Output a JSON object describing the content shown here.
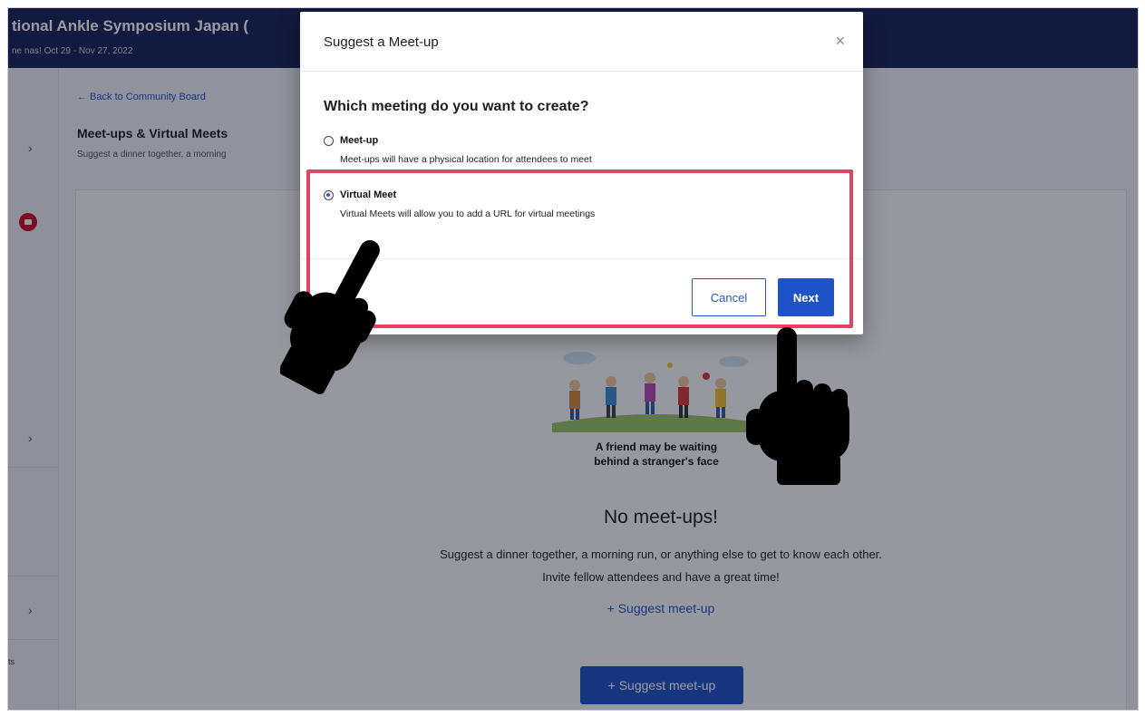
{
  "event": {
    "title": "tional Ankle Symposium Japan (",
    "dates": "ne nas!  Oct 29 - Nov 27, 2022"
  },
  "sidebar": {
    "chevron": "›",
    "footer_text": "ts"
  },
  "page": {
    "back_link": "← Back to Community Board",
    "title": "Meet-ups & Virtual Meets",
    "subtitle": "Suggest a dinner together, a morning"
  },
  "empty_state": {
    "caption_line1": "A friend may be waiting",
    "caption_line2": "behind a stranger's face",
    "title": "No meet-ups!",
    "body_line1": "Suggest a dinner together, a morning run, or anything else to get to know each other.",
    "body_line2": "Invite fellow attendees and have a great time!",
    "suggest_link": "+ Suggest meet-up",
    "suggest_button": "+ Suggest meet-up"
  },
  "modal": {
    "title": "Suggest a Meet-up",
    "close": "×",
    "question": "Which meeting do you want to create?",
    "options": [
      {
        "label": "Meet-up",
        "description": "Meet-ups will have a physical location for attendees to meet",
        "selected": false
      },
      {
        "label": "Virtual Meet",
        "description": "Virtual Meets will allow you to add a URL for virtual meetings",
        "selected": true
      }
    ],
    "cancel": "Cancel",
    "next": "Next"
  },
  "colors": {
    "header_bg": "#1b2356",
    "accent": "#1f53c7",
    "highlight": "#e0445f",
    "badge": "#c8102e"
  },
  "icons": {
    "close": "close-icon",
    "back": "arrow-left-icon",
    "chevron": "chevron-right-icon",
    "pointer_hands": "pointing-hand-icon"
  }
}
